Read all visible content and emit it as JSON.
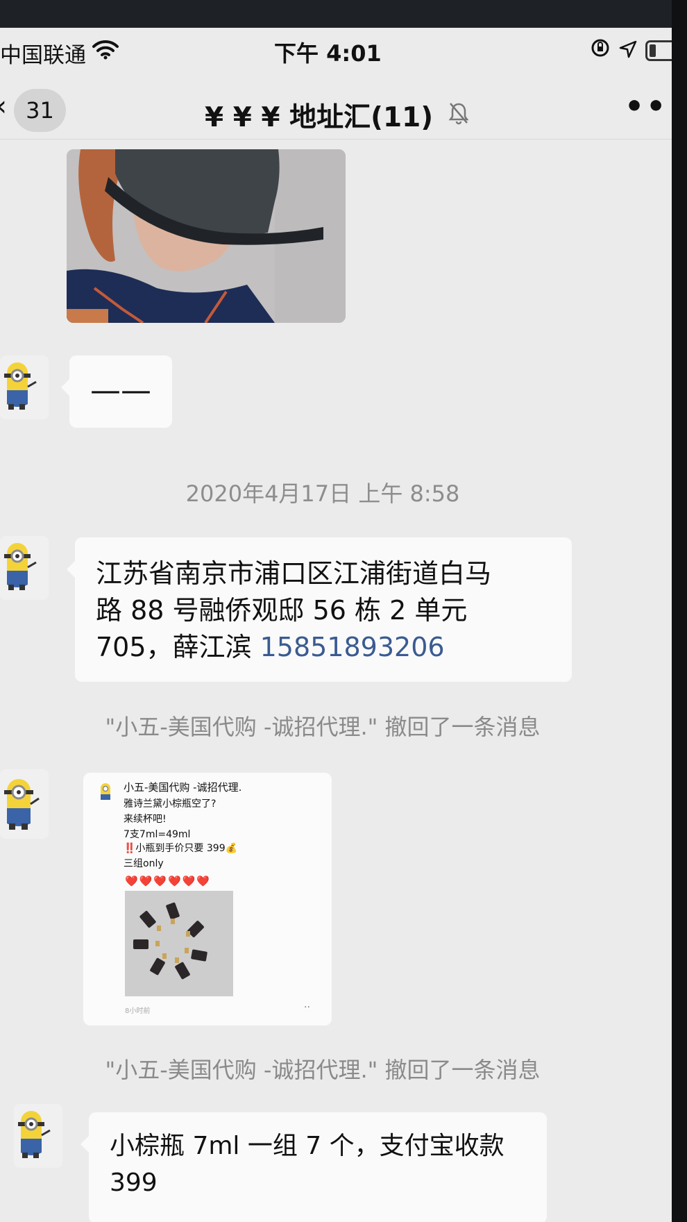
{
  "status_bar": {
    "carrier": "中国联通",
    "time": "下午 4:01"
  },
  "nav": {
    "back_count": "31",
    "title": "¥ ¥ ¥ 地址汇(11)",
    "more": "•••"
  },
  "messages": {
    "dash_text": "——",
    "timestamp": "2020年4月17日 上午 8:58",
    "address": {
      "line1": "江苏省南京市浦口区江浦街道白马",
      "line2": "路 88 号融侨观邸 56 栋 2 单元",
      "line3_prefix": "705，薛江滨 ",
      "phone": "15851893206"
    },
    "recall_1": "\"小五-美国代购 -诚招代理.\" 撤回了一条消息",
    "card": {
      "name": "小五-美国代购 -诚招代理.",
      "lines": [
        "雅诗兰黛小棕瓶空了?",
        "来续杯吧!",
        "7支7ml=49ml",
        "‼️小瓶到手价只要 399💰",
        "三组only"
      ],
      "hearts": "❤️❤️❤️❤️❤️❤️",
      "time": "8小时前",
      "more": "··"
    },
    "recall_2": "\"小五-美国代购 -诚招代理.\" 撤回了一条消息",
    "last": {
      "line1": "小棕瓶 7ml 一组 7 个，支付宝收款",
      "line2": "399"
    }
  },
  "icons": {
    "wifi": "wifi-icon",
    "orientation_lock": "orientation-lock-icon",
    "location": "location-arrow-icon",
    "battery": "battery-icon",
    "mute": "mute-bell-icon",
    "avatar": "minion-avatar"
  }
}
